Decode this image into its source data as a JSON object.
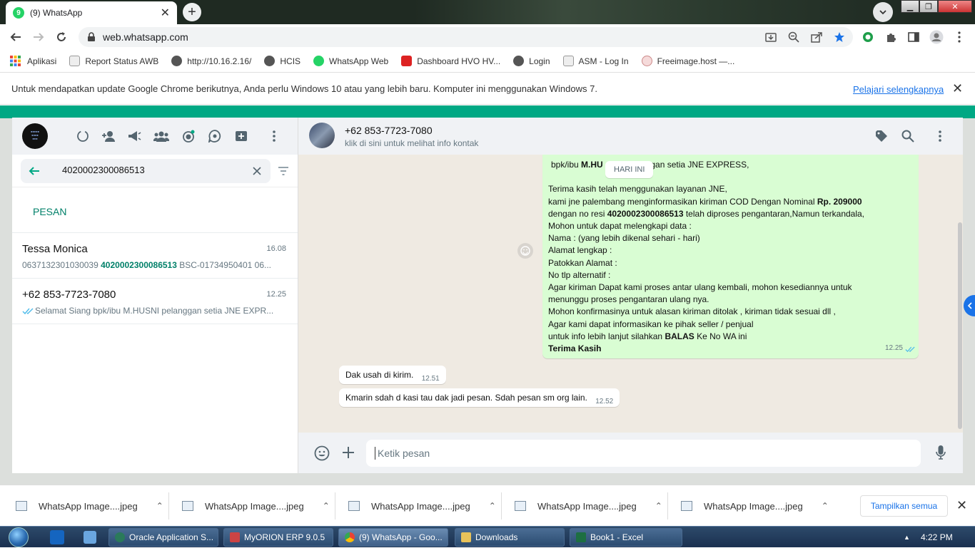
{
  "browser": {
    "tab_title": "(9) WhatsApp",
    "tab_badge": "9",
    "url": "web.whatsapp.com",
    "bookmarks": [
      "Aplikasi",
      "Report Status AWB",
      "http://10.16.2.16/",
      "HCIS",
      "WhatsApp Web",
      "Dashboard HVO HV...",
      "Login",
      "ASM - Log In",
      "Freeimage.host —..."
    ],
    "infobar_text": "Untuk mendapatkan update Google Chrome berikutnya, Anda perlu Windows 10 atau yang lebih baru. Komputer ini menggunakan Windows 7.",
    "infobar_link": "Pelajari selengkapnya",
    "colors": {
      "accent": "#1a73e8",
      "wa_green": "#00a884",
      "outgoing_bubble": "#d9fdd3"
    }
  },
  "whatsapp": {
    "search_value": "4020002300086513",
    "section_label": "PESAN",
    "chats": [
      {
        "name": "Tessa Monica",
        "time": "16.08",
        "preview_pre": "0637132301030039 ",
        "preview_bold": "4020002300086513",
        "preview_post": " BSC-01734950401 06..."
      },
      {
        "name": "+62 853-7723-7080",
        "time": "12.25",
        "preview_pre": "Selamat Siang   bpk/ibu M.HUSNI pelanggan setia JNE EXPR...",
        "preview_bold": "",
        "preview_post": ""
      }
    ],
    "contact": {
      "name": "+62 853-7723-7080",
      "subtitle": "klik di sini untuk melihat info kontak"
    },
    "day_chip": "HARI INI",
    "outgoing": {
      "l1_a": "bpk/ibu ",
      "l1_b": "M.HU",
      "l1_c": "ggan setia JNE EXPRESS,",
      "l2": "Terima kasih telah menggunakan layanan JNE,",
      "l3_a": "kami jne palembang menginformasikan kiriman  COD Dengan Nominal ",
      "l3_b": "Rp. 209000",
      "l4_a": "dengan no resi ",
      "l4_b": "4020002300086513",
      "l4_c": " telah diproses pengantaran,Namun terkandala,",
      "l5": "Mohon untuk dapat melengkapi data :",
      "l6": "Nama : (yang lebih dikenal sehari - hari)",
      "l7": "Alamat  lengkap :",
      "l8": "Patokkan Alamat :",
      "l9": "No tlp alternatif :",
      "l10": "Agar kiriman Dapat kami proses antar ulang kembali, mohon kesediannya untuk",
      "l11": "menunggu proses pengantaran ulang nya.",
      "l12": "Mohon konfirmasinya untuk alasan kiriman ditolak , kiriman tidak sesuai dll ,",
      "l13": "Agar kami dapat informasikan ke pihak seller / penjual",
      "l14_a": "untuk info lebih lanjut silahkan ",
      "l14_b": "BALAS",
      "l14_c": " Ke No WA ini",
      "l15": "Terima Kasih",
      "time": "12.25"
    },
    "incoming": [
      {
        "text": "Dak usah di kirim.",
        "time": "12.51"
      },
      {
        "text": "Kmarin sdah d kasi tau dak jadi pesan. Sdah pesan sm org lain.",
        "time": "12.52"
      }
    ],
    "composer_placeholder": "Ketik pesan"
  },
  "downloads": {
    "items": [
      "WhatsApp Image....jpeg",
      "WhatsApp Image....jpeg",
      "WhatsApp Image....jpeg",
      "WhatsApp Image....jpeg",
      "WhatsApp Image....jpeg"
    ],
    "show_all": "Tampilkan semua"
  },
  "taskbar": {
    "items": [
      "Oracle Application S...",
      "MyORION ERP 9.0.5",
      "(9) WhatsApp - Goo...",
      "Downloads",
      "Book1 - Excel"
    ],
    "clock": "4:22 PM"
  }
}
